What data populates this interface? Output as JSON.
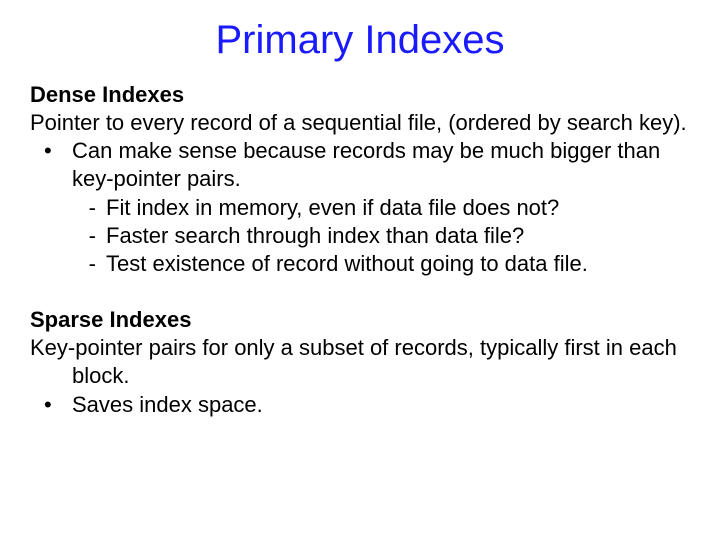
{
  "title": "Primary Indexes",
  "dense": {
    "heading": "Dense Indexes",
    "intro": "Pointer to every record of a sequential file, (ordered by search key).",
    "bullet": "Can make sense because records may be much bigger than key-pointer pairs.",
    "sub1": "Fit index in memory, even if data file does not?",
    "sub2": "Faster search through index than data file?",
    "sub3": "Test existence of record without going to data file."
  },
  "sparse": {
    "heading": "Sparse Indexes",
    "intro": "Key-pointer pairs for only a subset of records, typically first in each block.",
    "bullet": "Saves index space."
  }
}
